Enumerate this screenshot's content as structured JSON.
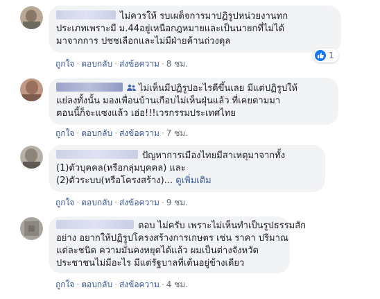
{
  "comments": [
    {
      "lines": [
        "ไม่ควรให้ รบเผด็จการมาปฏิรูปหน่วยงานทก",
        "ประเภทเพราะมี ม.44อยู่เหนือกฎหมายและเป็นนายกที่ไม่ได้",
        "มาจากการ ปชชเลือกและไม่มีฝ่ายค้านถ่วงดุล"
      ],
      "reaction_count": "1",
      "like": "ถูกใจ",
      "reply": "ตอบกลับ",
      "translate": "ส่งข้อความ",
      "time": "8 ชม."
    },
    {
      "lines": [
        "ไม่เห็นมีปฏิรูปอะไรดีขึ้นเลย มีแต่ปฏิรูปให้",
        "แย่ลงทั้งนั้น มองเพื่อนบ้านเกือบไม่เห็นฝุ่นแล้ว ที่เคยตามมา",
        "ตอนนี้ก็จะแซงแล้ว เฮ่อ!!!เวรกรรมประเทศไทย"
      ],
      "like": "ถูกใจ",
      "reply": "ตอบกลับ",
      "translate": "ส่งข้อความ",
      "time": "7 ชม."
    },
    {
      "lines": [
        "ปัญหาการเมืองไทยมีสาเหตุมาจากทั้ง",
        "(1)ตัวบุคคล(หรือกลุ่มบุคคล) และ",
        "(2)ตัวระบบ(หรือโครงสร้าง)..."
      ],
      "see_more": "ดูเพิ่มเติม",
      "like": "ถูกใจ",
      "reply": "ตอบกลับ",
      "translate": "ส่งข้อความ",
      "time": "9 ชม."
    },
    {
      "lines": [
        "ตอบ ไม่ครับ เพราะไม่เห็นทำเป็นรูปธรรมสัก",
        "อย่าง อยากให้ปฏิรูปโครงสร้างการเกษตร เช่น ราคา ปริมาณ",
        "แต่ละชนิด ความมั่นคงหยุดได้แล้ว ผมเป็นต่างจังหวัด",
        "ประชาชนไม่มีอะไร มีแต่รัฐบาลที่เต้นอยู่ข้างเดียว"
      ],
      "like": "ถูกใจ",
      "reply": "ตอบกลับ",
      "translate": "ส่งข้อความ",
      "time": "4 ชม."
    }
  ],
  "colors": {
    "bubble": "#f2f3f5",
    "link": "#385898",
    "meta": "#606770",
    "like_blue": "#1877f2"
  },
  "icons": [
    "like-icon",
    "friends-icon"
  ]
}
